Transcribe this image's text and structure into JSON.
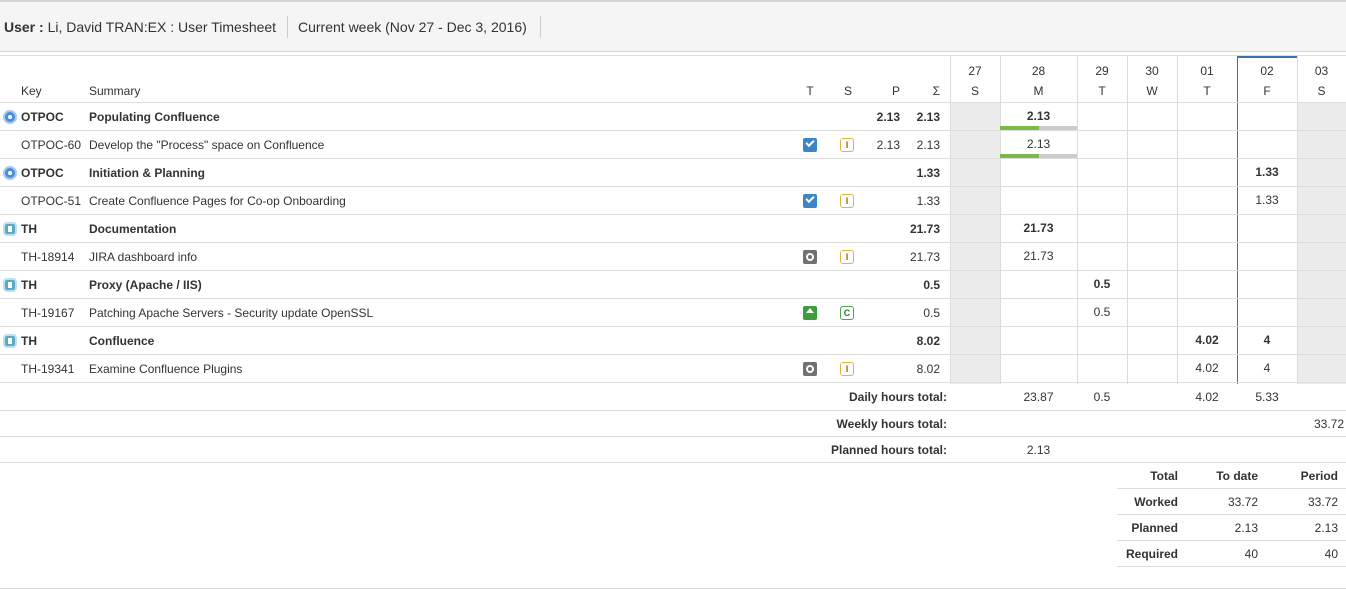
{
  "header": {
    "user_label": "User :",
    "user_value": "Li, David TRAN:EX : User Timesheet",
    "period": "Current week (Nov 27 - Dec 3, 2016)"
  },
  "columns": {
    "key": "Key",
    "summary": "Summary",
    "t": "T",
    "s": "S",
    "p": "P",
    "sum": "Σ"
  },
  "days": [
    {
      "num": "27",
      "dow": "S",
      "weekend": true
    },
    {
      "num": "28",
      "dow": "M",
      "weekend": false
    },
    {
      "num": "29",
      "dow": "T",
      "weekend": false
    },
    {
      "num": "30",
      "dow": "W",
      "weekend": false
    },
    {
      "num": "01",
      "dow": "T",
      "weekend": false
    },
    {
      "num": "02",
      "dow": "F",
      "weekend": false,
      "today": true
    },
    {
      "num": "03",
      "dow": "S",
      "weekend": true
    }
  ],
  "rows": [
    {
      "kind": "group",
      "icon": "otpoc-project-icon",
      "key": "OTPOC",
      "summary": "Populating Confluence",
      "p": "2.13",
      "total": "2.13",
      "day28": "2.13",
      "progress": 0.5
    },
    {
      "kind": "issue",
      "type": "task-checkbox-icon",
      "status": "I",
      "key": "OTPOC-60",
      "summary": "Develop the \"Process\" space on Confluence",
      "p": "2.13",
      "total": "2.13",
      "day28": "2.13",
      "progress": 0.5
    },
    {
      "kind": "group",
      "icon": "otpoc-project-icon",
      "key": "OTPOC",
      "summary": "Initiation & Planning",
      "p": "",
      "total": "1.33",
      "day02": "1.33"
    },
    {
      "kind": "issue",
      "type": "task-checkbox-icon",
      "status": "I",
      "key": "OTPOC-51",
      "summary": "Create Confluence Pages for Co-op Onboarding",
      "p": "",
      "total": "1.33",
      "day02": "1.33"
    },
    {
      "kind": "group",
      "icon": "th-project-icon",
      "key": "TH",
      "summary": "Documentation",
      "p": "",
      "total": "21.73",
      "day28": "21.73"
    },
    {
      "kind": "issue",
      "type": "subtask-icon",
      "status": "I",
      "key": "TH-18914",
      "summary": "JIRA dashboard info",
      "p": "",
      "total": "21.73",
      "day28": "21.73"
    },
    {
      "kind": "group",
      "icon": "th-project-icon",
      "key": "TH",
      "summary": "Proxy (Apache / IIS)",
      "p": "",
      "total": "0.5",
      "day29": "0.5"
    },
    {
      "kind": "issue",
      "type": "improvement-icon",
      "status": "C",
      "key": "TH-19167",
      "summary": "Patching Apache Servers - Security update OpenSSL",
      "p": "",
      "total": "0.5",
      "day29": "0.5"
    },
    {
      "kind": "group",
      "icon": "th-project-icon",
      "key": "TH",
      "summary": "Confluence",
      "p": "",
      "total": "8.02",
      "day01": "4.02",
      "day02": "4"
    },
    {
      "kind": "issue",
      "type": "subtask-icon",
      "status": "I",
      "key": "TH-19341",
      "summary": "Examine Confluence Plugins",
      "p": "",
      "total": "8.02",
      "day01": "4.02",
      "day02": "4"
    }
  ],
  "totals": {
    "daily_label": "Daily hours total:",
    "daily": {
      "day28": "23.87",
      "day29": "0.5",
      "day01": "4.02",
      "day02": "5.33"
    },
    "weekly_label": "Weekly hours total:",
    "weekly": "33.72",
    "planned_label": "Planned hours total:",
    "planned_day28": "2.13"
  },
  "summary_table": {
    "headers": [
      "Total",
      "To date",
      "Period"
    ],
    "rows": [
      {
        "label": "Worked",
        "to_date": "33.72",
        "period": "33.72"
      },
      {
        "label": "Planned",
        "to_date": "2.13",
        "period": "2.13"
      },
      {
        "label": "Required",
        "to_date": "40",
        "period": "40"
      }
    ]
  }
}
